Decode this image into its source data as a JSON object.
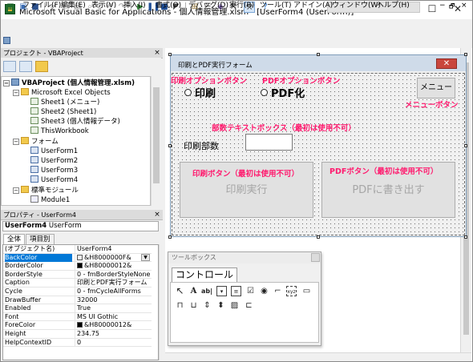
{
  "window": {
    "title": "Microsoft Visual Basic for Applications - 個人情報管理.xlsm - [UserForm4 (UserForm)]",
    "min": "—",
    "max": "☐",
    "close": "✕"
  },
  "menu": [
    "ファイル(F)",
    "編集(E)",
    "表示(V)",
    "挿入(I)",
    "書式(O)",
    "デバッグ(D)",
    "実行(R)",
    "ツール(T)",
    "アドイン(A)",
    "ウィンドウ(W)",
    "ヘルプ(H)"
  ],
  "menu_right": {
    "min": "−",
    "restore": "🗗",
    "close": "×"
  },
  "project": {
    "title": "プロジェクト - VBAProject",
    "close": "×",
    "tree": [
      {
        "label": "VBAProject (個人情報管理.xlsm)",
        "kind": "vba",
        "pm": "−"
      },
      {
        "label": "Microsoft Excel Objects",
        "kind": "folder",
        "pm": "−"
      },
      {
        "label": "Sheet1 (メニュー)",
        "kind": "sheet"
      },
      {
        "label": "Sheet2 (Sheet1)",
        "kind": "sheet"
      },
      {
        "label": "Sheet3 (個人情報データ)",
        "kind": "sheet"
      },
      {
        "label": "ThisWorkbook",
        "kind": "sheet"
      },
      {
        "label": "フォーム",
        "kind": "folder",
        "pm": "−"
      },
      {
        "label": "UserForm1",
        "kind": "form"
      },
      {
        "label": "UserForm2",
        "kind": "form"
      },
      {
        "label": "UserForm3",
        "kind": "form"
      },
      {
        "label": "UserForm4",
        "kind": "form"
      },
      {
        "label": "標準モジュール",
        "kind": "folder",
        "pm": "−"
      },
      {
        "label": "Module1",
        "kind": "module"
      }
    ]
  },
  "properties": {
    "title": "プロパティ - UserForm4",
    "close": "×",
    "object_bold": "UserForm4",
    "object_type": "UserForm",
    "tabs": [
      "全体",
      "項目別"
    ],
    "rows": [
      {
        "name": "(オブジェクト名)",
        "value": "UserForm4"
      },
      {
        "name": "BackColor",
        "value": "&H8000000F&",
        "swatch": "#f0f0f0",
        "selected": true
      },
      {
        "name": "BorderColor",
        "value": "&H80000012&",
        "swatch": "#000000"
      },
      {
        "name": "BorderStyle",
        "value": "0 - fmBorderStyleNone"
      },
      {
        "name": "Caption",
        "value": "印刷とPDF実行フォーム"
      },
      {
        "name": "Cycle",
        "value": "0 - fmCycleAllForms"
      },
      {
        "name": "DrawBuffer",
        "value": "32000"
      },
      {
        "name": "Enabled",
        "value": "True"
      },
      {
        "name": "Font",
        "value": "MS UI Gothic"
      },
      {
        "name": "ForeColor",
        "value": "&H80000012&",
        "swatch": "#000000"
      },
      {
        "name": "Height",
        "value": "234.75"
      },
      {
        "name": "HelpContextID",
        "value": "0"
      }
    ]
  },
  "form": {
    "caption": "印刷とPDF実行フォーム",
    "close": "✕",
    "option_print": "印刷",
    "option_pdf": "PDF化",
    "menu_button": "メニュー",
    "copies_label": "印刷部数",
    "print_button": "印刷実行",
    "pdf_button": "PDFに書き出す"
  },
  "annotations": {
    "print_option": "印刷オプションボタン",
    "pdf_option": "PDFオプションボタン",
    "menu_button": "メニューボタン",
    "copies_textbox": "部数テキストボックス（最初は使用不可）",
    "print_button": "印刷ボタン（最初は使用不可）",
    "pdf_button": "PDFボタン（最初は使用不可）"
  },
  "toolbox": {
    "title": "ツールボックス",
    "tab": "コントロール",
    "tools_row1": [
      "pointer-icon",
      "label-icon",
      "textbox-icon",
      "combobox-icon",
      "listbox-icon",
      "checkbox-icon",
      "optionbutton-icon",
      "togglebutton-icon",
      "frame-icon",
      "commandbutton-icon"
    ],
    "tools_row2": [
      "tabstrip-icon",
      "multipage-icon",
      "scrollbar-icon",
      "spinbutton-icon",
      "image-icon",
      "refedit-icon"
    ]
  },
  "colors": {
    "annotation": "#ff1a6e",
    "selection": "#0078d7"
  }
}
